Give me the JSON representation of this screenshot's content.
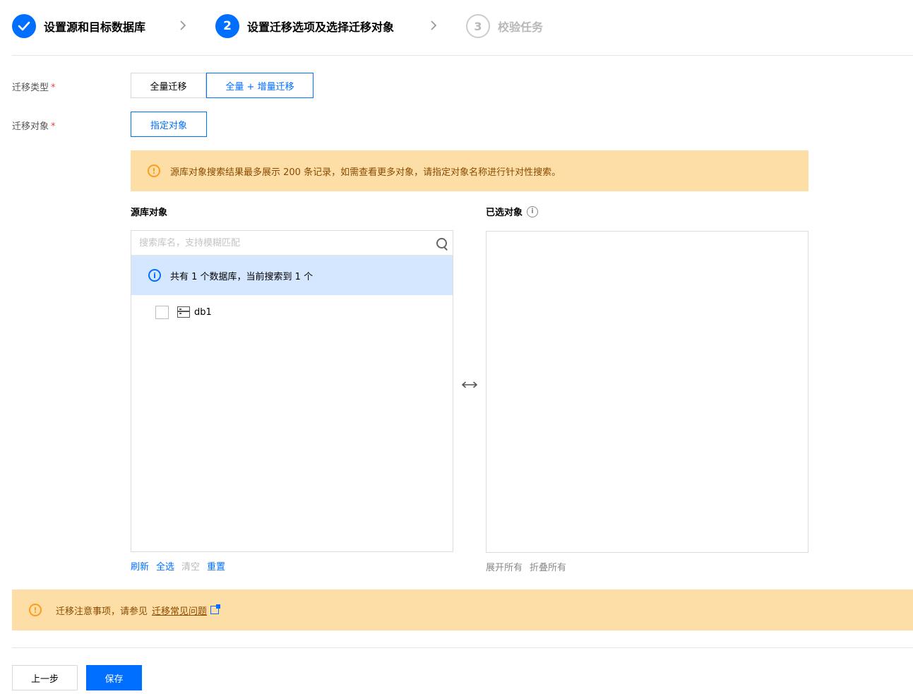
{
  "steps": [
    {
      "label": "设置源和目标数据库",
      "state": "done",
      "icon": "check-icon"
    },
    {
      "number": "2",
      "label": "设置迁移选项及选择迁移对象",
      "state": "active"
    },
    {
      "number": "3",
      "label": "校验任务",
      "state": "todo"
    }
  ],
  "form": {
    "migration_type_label": "迁移类型",
    "migration_type_options": [
      "全量迁移",
      "全量 + 增量迁移"
    ],
    "migration_type_selected": "全量 + 增量迁移",
    "migration_object_label": "迁移对象",
    "migration_object_button": "指定对象",
    "required_mark": "*"
  },
  "warning_top": {
    "text": "源库对象搜索结果最多展示 200 条记录，如需查看更多对象，请指定对象名称进行针对性搜索。"
  },
  "source_panel": {
    "title": "源库对象",
    "search_placeholder": "搜索库名，支持模糊匹配",
    "info_text": "共有 1 个数据库，当前搜索到 1 个",
    "items": [
      {
        "name": "db1",
        "checked": false
      }
    ],
    "actions": {
      "refresh": "刷新",
      "select_all": "全选",
      "clear": "清空",
      "reset": "重置"
    }
  },
  "selected_panel": {
    "title": "已选对象",
    "actions": {
      "expand_all": "展开所有",
      "collapse_all": "折叠所有"
    }
  },
  "warning_bottom": {
    "text": "迁移注意事项，请参见",
    "link": "迁移常见问题"
  },
  "footer": {
    "prev_button": "上一步",
    "save_button": "保存"
  },
  "colors": {
    "primary": "#006eff",
    "warning_bg": "#fddea6",
    "warning_icon": "#ff9c19",
    "info_bg": "#d5e7ff"
  }
}
